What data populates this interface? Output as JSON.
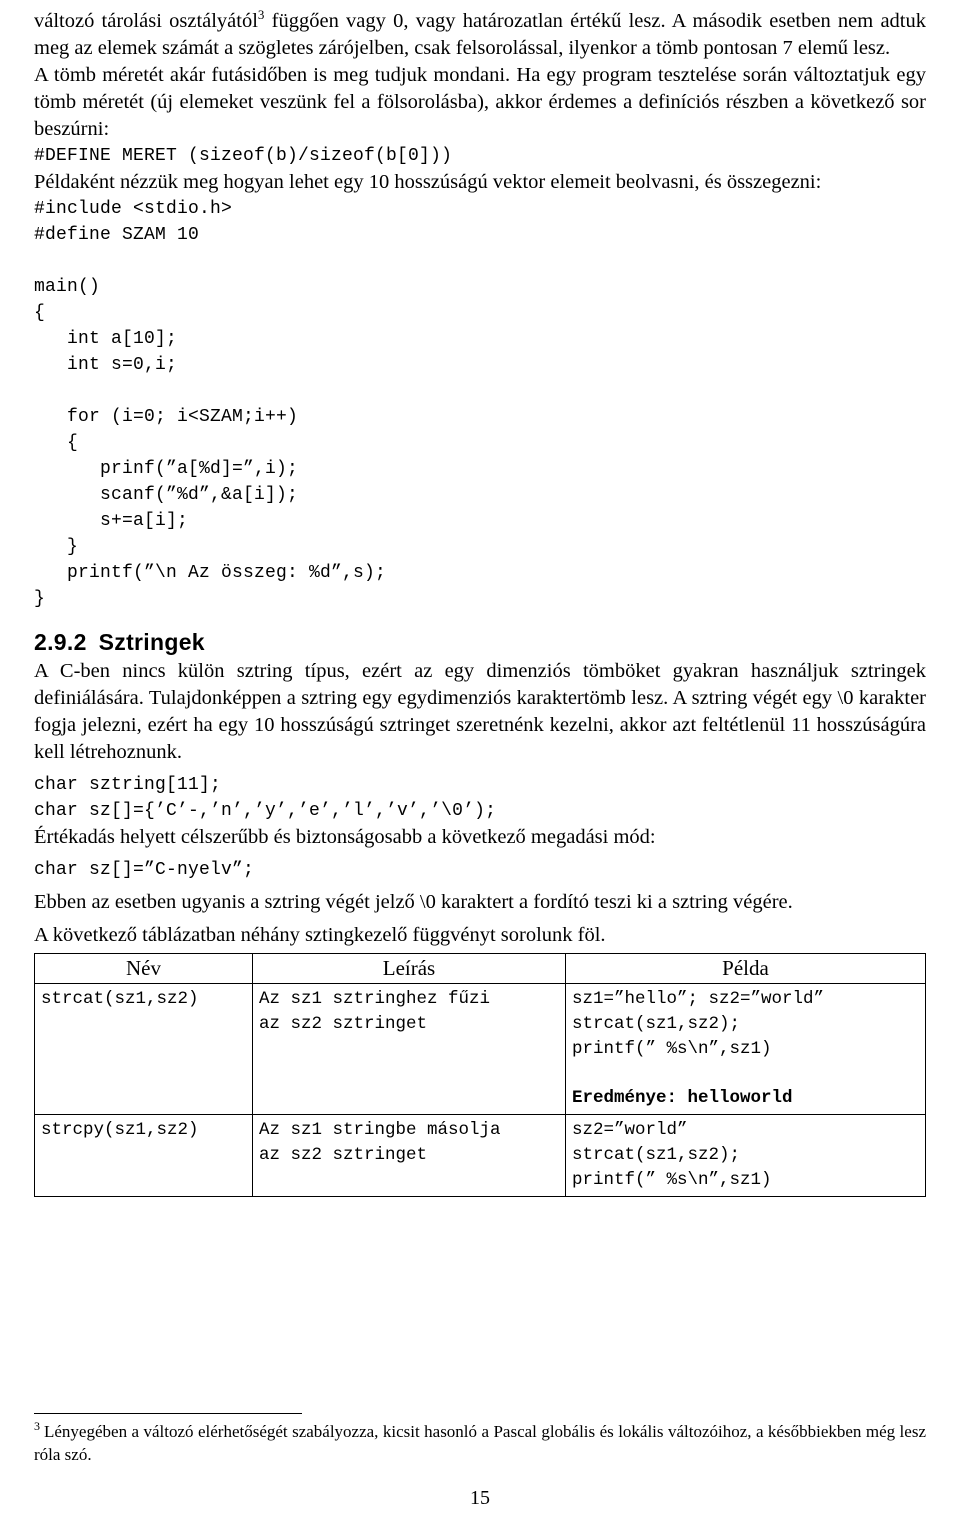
{
  "document": {
    "paragraphs": {
      "p1_part1": "változó tárolási osztályától",
      "p1_footnote_mark": "3",
      "p1_part2": " függően vagy 0, vagy határozatlan értékű lesz. A második esetben nem adtuk meg az elemek számát a szögletes zárójelben, csak felsorolással, ilyenkor a tömb pontosan 7 elemű lesz.",
      "p2": "A tömb méretét akár futásidőben is meg tudjuk mondani. Ha egy program tesztelése során változtatjuk egy tömb méretét (új elemeket veszünk fel a fölsorolásba), akkor érdemes a definíciós részben a következő sor beszúrni:",
      "p3": "Példaként nézzük meg hogyan lehet egy 10 hosszúságú vektor elemeit beolvasni, és összegezni:",
      "p4": "A C-ben nincs külön sztring típus, ezért az egy dimenziós tömböket gyakran használjuk sztringek definiálására. Tulajdonképpen a sztring egy egydimenziós karaktertömb lesz. A sztring végét egy \\0 karakter fogja jelezni, ezért ha egy 10 hosszúságú sztringet szeretnénk kezelni, akkor azt feltétlenül 11 hosszúságúra kell létrehoznunk.",
      "p5": "Értékadás helyett célszerűbb és biztonságosabb a következő megadási mód:",
      "p6": "Ebben az esetben ugyanis a sztring végét jelző \\0 karaktert a fordító teszi ki a sztring végére.",
      "p7": "A következő táblázatban néhány sztingkezelő függvényt sorolunk föl."
    },
    "code_blocks": {
      "define_line": "#DEFINE MERET (sizeof(b)/sizeof(b[0]))",
      "main_program": "#include <stdio.h>\n#define SZAM 10\n\nmain()\n{\n   int a[10];\n   int s=0,i;\n\n   for (i=0; i<SZAM;i++)\n   {\n      prinf(”a[%d]=”,i);\n      scanf(”%d”,&a[i]);\n      s+=a[i];\n   }\n   printf(”\\n Az összeg: %d”,s);\n}",
      "sztring_decl": "char sztring[11];\nchar sz[]={’C’-,’n’,’y’,’e’,’l’,’v’,’\\0’);",
      "sztring_init": "char sz[]=”C-nyelv”;"
    },
    "heading": {
      "number": "2.9.2",
      "title": "Sztringek"
    },
    "table": {
      "headers": [
        "Név",
        "Leírás",
        "Példa"
      ],
      "rows": [
        {
          "name": "strcat(sz1,sz2)",
          "desc": "Az sz1 sztringhez fűzi\naz sz2 sztringet",
          "example": "sz1=”hello”; sz2=”world”\nstrcat(sz1,sz2);\nprintf(” %s\\n”,sz1)",
          "result": "Eredménye: helloworld"
        },
        {
          "name": "strcpy(sz1,sz2)",
          "desc": "Az sz1 stringbe másolja\naz sz2 sztringet",
          "example": "sz2=”world”\nstrcat(sz1,sz2);\nprintf(” %s\\n”,sz1)",
          "result": ""
        }
      ]
    },
    "footnote": {
      "mark": "3",
      "text": "Lényegében a változó elérhetőségét szabályozza, kicsit hasonló a Pascal globális és lokális változóihoz, a későbbiekben még lesz róla szó."
    },
    "page_number": "15"
  }
}
